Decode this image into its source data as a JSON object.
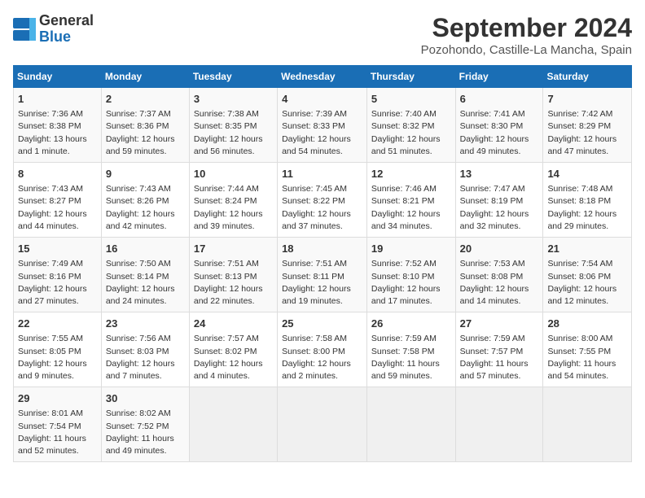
{
  "header": {
    "logo_text_general": "General",
    "logo_text_blue": "Blue",
    "month_title": "September 2024",
    "location": "Pozohondo, Castille-La Mancha, Spain"
  },
  "days_of_week": [
    "Sunday",
    "Monday",
    "Tuesday",
    "Wednesday",
    "Thursday",
    "Friday",
    "Saturday"
  ],
  "weeks": [
    [
      {
        "day": "1",
        "info": "Sunrise: 7:36 AM\nSunset: 8:38 PM\nDaylight: 13 hours\nand 1 minute."
      },
      {
        "day": "2",
        "info": "Sunrise: 7:37 AM\nSunset: 8:36 PM\nDaylight: 12 hours\nand 59 minutes."
      },
      {
        "day": "3",
        "info": "Sunrise: 7:38 AM\nSunset: 8:35 PM\nDaylight: 12 hours\nand 56 minutes."
      },
      {
        "day": "4",
        "info": "Sunrise: 7:39 AM\nSunset: 8:33 PM\nDaylight: 12 hours\nand 54 minutes."
      },
      {
        "day": "5",
        "info": "Sunrise: 7:40 AM\nSunset: 8:32 PM\nDaylight: 12 hours\nand 51 minutes."
      },
      {
        "day": "6",
        "info": "Sunrise: 7:41 AM\nSunset: 8:30 PM\nDaylight: 12 hours\nand 49 minutes."
      },
      {
        "day": "7",
        "info": "Sunrise: 7:42 AM\nSunset: 8:29 PM\nDaylight: 12 hours\nand 47 minutes."
      }
    ],
    [
      {
        "day": "8",
        "info": "Sunrise: 7:43 AM\nSunset: 8:27 PM\nDaylight: 12 hours\nand 44 minutes."
      },
      {
        "day": "9",
        "info": "Sunrise: 7:43 AM\nSunset: 8:26 PM\nDaylight: 12 hours\nand 42 minutes."
      },
      {
        "day": "10",
        "info": "Sunrise: 7:44 AM\nSunset: 8:24 PM\nDaylight: 12 hours\nand 39 minutes."
      },
      {
        "day": "11",
        "info": "Sunrise: 7:45 AM\nSunset: 8:22 PM\nDaylight: 12 hours\nand 37 minutes."
      },
      {
        "day": "12",
        "info": "Sunrise: 7:46 AM\nSunset: 8:21 PM\nDaylight: 12 hours\nand 34 minutes."
      },
      {
        "day": "13",
        "info": "Sunrise: 7:47 AM\nSunset: 8:19 PM\nDaylight: 12 hours\nand 32 minutes."
      },
      {
        "day": "14",
        "info": "Sunrise: 7:48 AM\nSunset: 8:18 PM\nDaylight: 12 hours\nand 29 minutes."
      }
    ],
    [
      {
        "day": "15",
        "info": "Sunrise: 7:49 AM\nSunset: 8:16 PM\nDaylight: 12 hours\nand 27 minutes."
      },
      {
        "day": "16",
        "info": "Sunrise: 7:50 AM\nSunset: 8:14 PM\nDaylight: 12 hours\nand 24 minutes."
      },
      {
        "day": "17",
        "info": "Sunrise: 7:51 AM\nSunset: 8:13 PM\nDaylight: 12 hours\nand 22 minutes."
      },
      {
        "day": "18",
        "info": "Sunrise: 7:51 AM\nSunset: 8:11 PM\nDaylight: 12 hours\nand 19 minutes."
      },
      {
        "day": "19",
        "info": "Sunrise: 7:52 AM\nSunset: 8:10 PM\nDaylight: 12 hours\nand 17 minutes."
      },
      {
        "day": "20",
        "info": "Sunrise: 7:53 AM\nSunset: 8:08 PM\nDaylight: 12 hours\nand 14 minutes."
      },
      {
        "day": "21",
        "info": "Sunrise: 7:54 AM\nSunset: 8:06 PM\nDaylight: 12 hours\nand 12 minutes."
      }
    ],
    [
      {
        "day": "22",
        "info": "Sunrise: 7:55 AM\nSunset: 8:05 PM\nDaylight: 12 hours\nand 9 minutes."
      },
      {
        "day": "23",
        "info": "Sunrise: 7:56 AM\nSunset: 8:03 PM\nDaylight: 12 hours\nand 7 minutes."
      },
      {
        "day": "24",
        "info": "Sunrise: 7:57 AM\nSunset: 8:02 PM\nDaylight: 12 hours\nand 4 minutes."
      },
      {
        "day": "25",
        "info": "Sunrise: 7:58 AM\nSunset: 8:00 PM\nDaylight: 12 hours\nand 2 minutes."
      },
      {
        "day": "26",
        "info": "Sunrise: 7:59 AM\nSunset: 7:58 PM\nDaylight: 11 hours\nand 59 minutes."
      },
      {
        "day": "27",
        "info": "Sunrise: 7:59 AM\nSunset: 7:57 PM\nDaylight: 11 hours\nand 57 minutes."
      },
      {
        "day": "28",
        "info": "Sunrise: 8:00 AM\nSunset: 7:55 PM\nDaylight: 11 hours\nand 54 minutes."
      }
    ],
    [
      {
        "day": "29",
        "info": "Sunrise: 8:01 AM\nSunset: 7:54 PM\nDaylight: 11 hours\nand 52 minutes."
      },
      {
        "day": "30",
        "info": "Sunrise: 8:02 AM\nSunset: 7:52 PM\nDaylight: 11 hours\nand 49 minutes."
      },
      null,
      null,
      null,
      null,
      null
    ]
  ]
}
